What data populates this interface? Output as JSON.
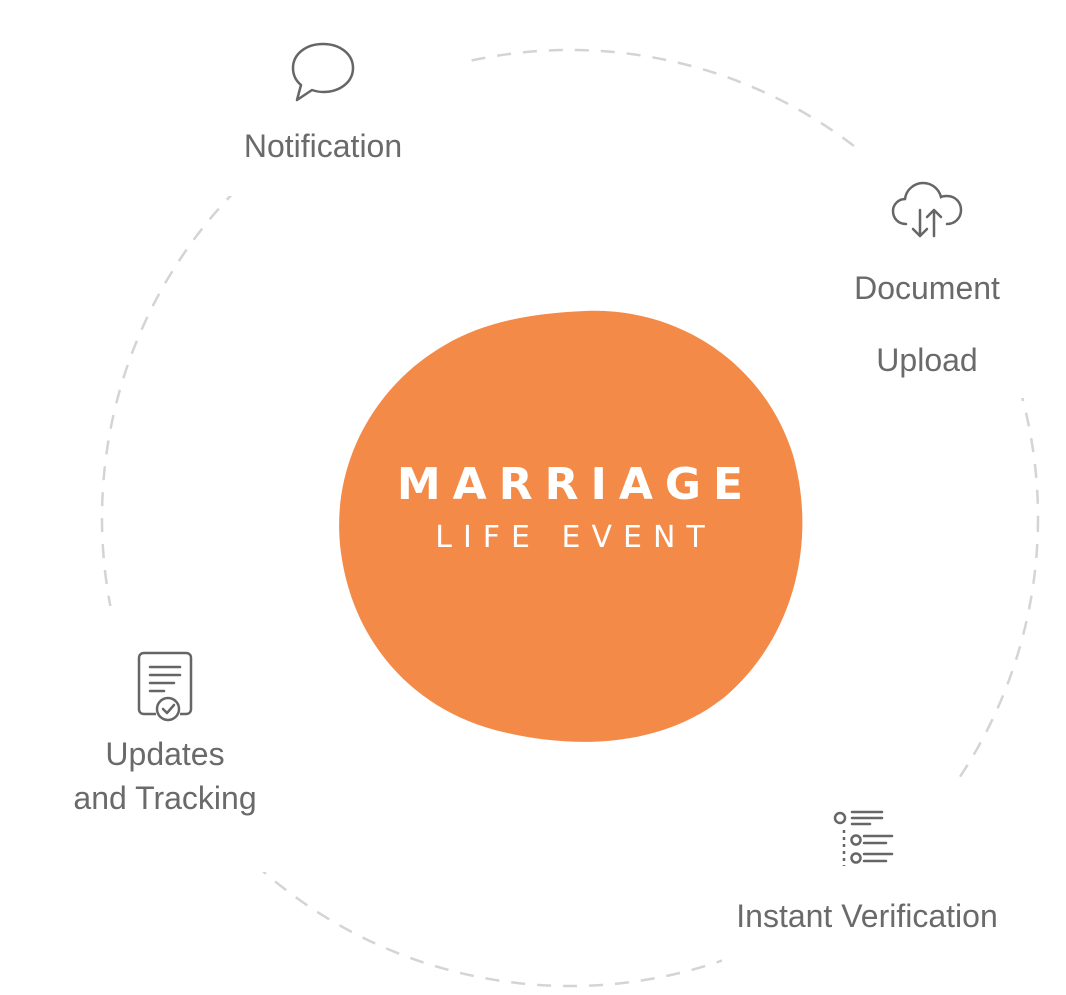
{
  "center": {
    "title": "MARRIAGE",
    "subtitle": "LIFE EVENT"
  },
  "nodes": {
    "notification": {
      "label": "Notification",
      "icon": "speech-bubble-icon"
    },
    "document_upload": {
      "label_line1": "Document",
      "label_line2": "Upload",
      "icon": "cloud-upload-download-icon"
    },
    "updates_tracking": {
      "label_line1": "Updates",
      "label_line2": "and Tracking",
      "icon": "certificate-check-icon"
    },
    "instant_verification": {
      "label": "Instant Verification",
      "icon": "checklist-icon"
    }
  },
  "colors": {
    "center_fill": "#f38a48",
    "center_text": "#ffffff",
    "node_text": "#6a6a6a",
    "icon_stroke": "#666666",
    "ring_dash": "#d4d4d4"
  }
}
